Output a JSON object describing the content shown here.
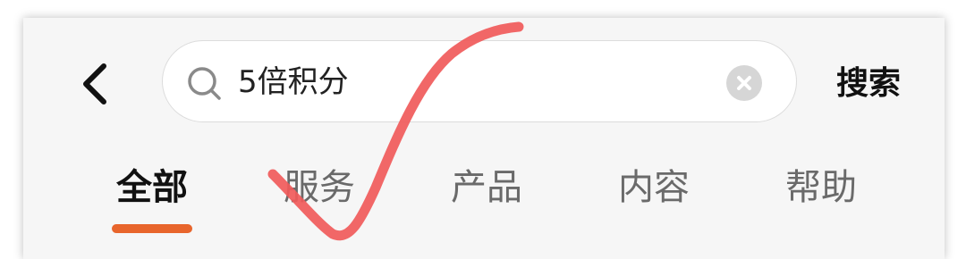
{
  "search": {
    "value": "5倍积分",
    "action_label": "搜索"
  },
  "tabs": [
    {
      "label": "全部",
      "active": true
    },
    {
      "label": "服务",
      "active": false
    },
    {
      "label": "产品",
      "active": false
    },
    {
      "label": "内容",
      "active": false
    },
    {
      "label": "帮助",
      "active": false
    }
  ],
  "colors": {
    "accent": "#e8652c",
    "annotation_stroke": "#f05a5a"
  },
  "icons": {
    "back": "chevron-left-icon",
    "search": "search-icon",
    "clear": "clear-icon"
  }
}
